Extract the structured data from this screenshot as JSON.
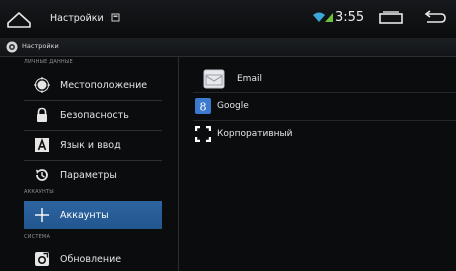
{
  "status_bar": {
    "title": "Настройки",
    "clock": "3:55",
    "icons": [
      "home-icon",
      "sd-card-icon",
      "wifi-icon",
      "signal-icon",
      "recent-apps-icon",
      "back-icon"
    ]
  },
  "action_bar": {
    "title": "Настройки",
    "icon": "settings-app-icon"
  },
  "sidebar": {
    "section_personal": "ЛИЧНЫЕ ДАННЫЕ",
    "section_accounts": "АККАУНТЫ",
    "section_system": "СИСТЕМА",
    "items": [
      {
        "label": "Местоположение",
        "icon": "location-icon"
      },
      {
        "label": "Безопасность",
        "icon": "lock-icon"
      },
      {
        "label": "Язык и ввод",
        "icon": "keyboard-a-icon"
      },
      {
        "label": "Параметры",
        "icon": "restore-icon"
      },
      {
        "label": "Аккаунты",
        "icon": "plus-icon",
        "selected": true
      },
      {
        "label": "Обновление",
        "icon": "update-icon"
      }
    ]
  },
  "accounts": [
    {
      "label": "Email",
      "icon": "email-icon"
    },
    {
      "label": "Google",
      "icon": "google-icon"
    },
    {
      "label": "Корпоративный",
      "icon": "corporate-icon"
    }
  ],
  "colors": {
    "background": "#0b0c0e",
    "selected": "#2a5f99",
    "accent_wifi": "#3aa7d8",
    "accent_signal": "#6cc23a",
    "google_blue": "#3c7ad0"
  }
}
